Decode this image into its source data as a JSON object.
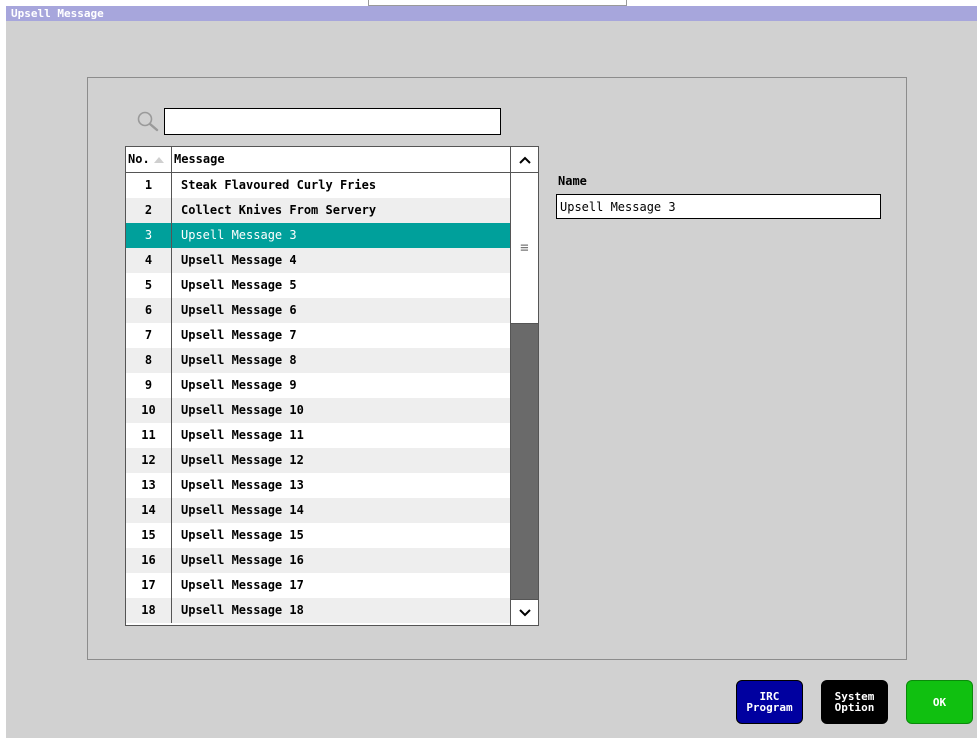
{
  "window": {
    "title": "Upsell Message"
  },
  "search": {
    "value": "",
    "placeholder": ""
  },
  "table": {
    "columns": {
      "no": "No.",
      "message": "Message"
    },
    "selected_index": 2,
    "rows": [
      {
        "no": "1",
        "message": "Steak Flavoured Curly Fries"
      },
      {
        "no": "2",
        "message": "Collect Knives From Servery"
      },
      {
        "no": "3",
        "message": "Upsell Message 3"
      },
      {
        "no": "4",
        "message": "Upsell Message 4"
      },
      {
        "no": "5",
        "message": "Upsell Message 5"
      },
      {
        "no": "6",
        "message": "Upsell Message 6"
      },
      {
        "no": "7",
        "message": "Upsell Message 7"
      },
      {
        "no": "8",
        "message": "Upsell Message 8"
      },
      {
        "no": "9",
        "message": "Upsell Message 9"
      },
      {
        "no": "10",
        "message": "Upsell Message 10"
      },
      {
        "no": "11",
        "message": "Upsell Message 11"
      },
      {
        "no": "12",
        "message": "Upsell Message 12"
      },
      {
        "no": "13",
        "message": "Upsell Message 13"
      },
      {
        "no": "14",
        "message": "Upsell Message 14"
      },
      {
        "no": "15",
        "message": "Upsell Message 15"
      },
      {
        "no": "16",
        "message": "Upsell Message 16"
      },
      {
        "no": "17",
        "message": "Upsell Message 17"
      },
      {
        "no": "18",
        "message": "Upsell Message 18"
      }
    ]
  },
  "detail": {
    "name_label": "Name",
    "name_value": "Upsell Message 3"
  },
  "buttons": {
    "irc_program": "IRC\nProgram",
    "system_option": "System\nOption",
    "ok": "OK"
  },
  "colors": {
    "title_bar": "#a7a6dc",
    "selection": "#00a09b",
    "irc_button": "#0000a0",
    "system_button": "#000000",
    "ok_button": "#10c010"
  },
  "icons": {
    "search": "magnifier-icon",
    "sort": "sort-ascending-icon",
    "scroll_up": "chevron-up-icon",
    "scroll_down": "chevron-down-icon",
    "scroll_grip": "grip-icon"
  }
}
